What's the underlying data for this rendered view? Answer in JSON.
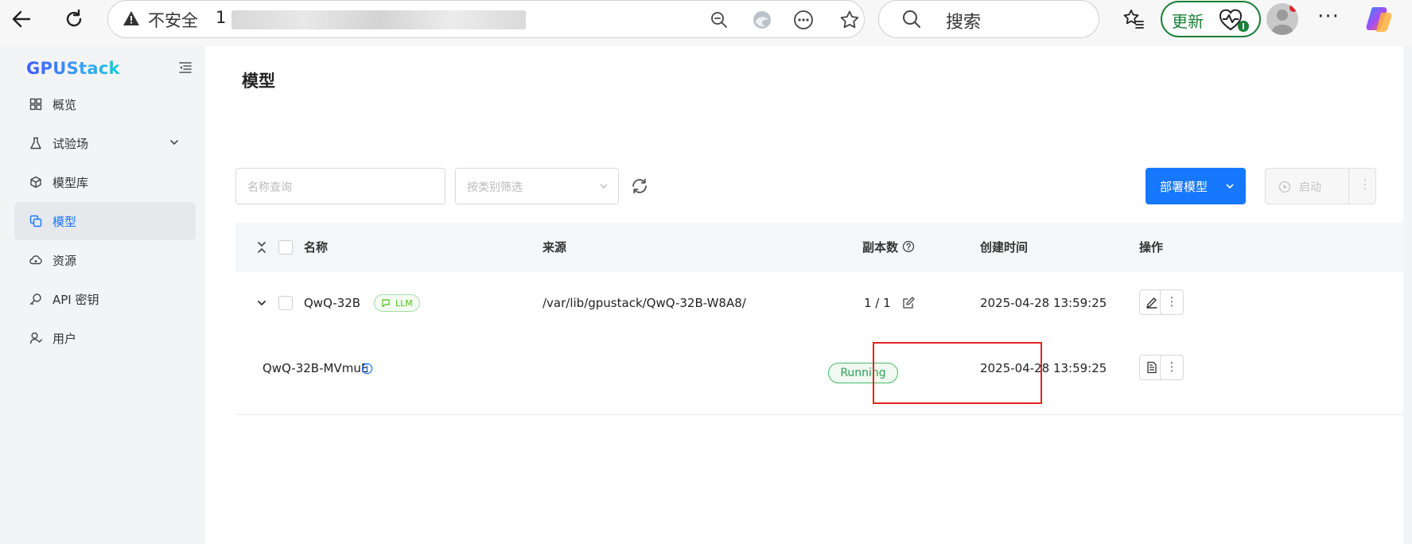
{
  "browser": {
    "security_label": "不安全",
    "url_visible_prefix": "1",
    "search_placeholder": "搜索",
    "update_label": "更新",
    "more_label": "···"
  },
  "sidebar": {
    "logo": "GPUStack",
    "items": [
      {
        "label": "概览",
        "icon": "dashboard-icon"
      },
      {
        "label": "试验场",
        "icon": "flask-icon",
        "expandable": true
      },
      {
        "label": "模型库",
        "icon": "cube-icon"
      },
      {
        "label": "模型",
        "icon": "model-icon",
        "active": true
      },
      {
        "label": "资源",
        "icon": "cloud-icon"
      },
      {
        "label": "API 密钥",
        "icon": "key-icon"
      },
      {
        "label": "用户",
        "icon": "user-icon"
      }
    ]
  },
  "main": {
    "title": "模型",
    "toolbar": {
      "name_placeholder": "名称查询",
      "category_placeholder": "按类别筛选",
      "deploy_label": "部署模型",
      "start_label": "启动",
      "more_label": "⋮"
    },
    "table": {
      "headers": {
        "name": "名称",
        "source": "来源",
        "replicas": "副本数",
        "created": "创建时间",
        "actions": "操作"
      },
      "model": {
        "name": "QwQ-32B",
        "tag": "LLM",
        "source": "/var/lib/gpustack/QwQ-32B-W8A8/",
        "replicas": "1 / 1",
        "created": "2025-04-28 13:59:25"
      },
      "instance": {
        "name": "QwQ-32B-MVmuE",
        "status": "Running",
        "created": "2025-04-28 13:59:25"
      }
    }
  },
  "colors": {
    "primary": "#1677ff",
    "running": "#2f9e52",
    "highlight": "#e52323",
    "update_green": "#1a7f37"
  }
}
